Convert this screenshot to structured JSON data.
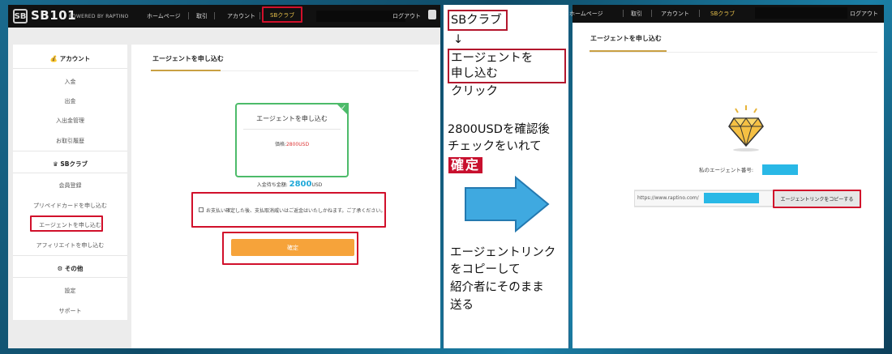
{
  "left": {
    "logo_icon": "SB",
    "logo_text": "SB101",
    "powered": "POWERED BY RAPTINO",
    "nav": [
      "ホームページ",
      "取引",
      "アカウント",
      "SBクラブ"
    ],
    "logout": "ログアウト",
    "sidebar": {
      "account_head": "アカウント",
      "account_items": [
        "入金",
        "出金",
        "入出金管理",
        "お取引履歴"
      ],
      "club_head": "SBクラブ",
      "club_items": [
        "会員登録",
        "プリペイドカードを申し込む",
        "エージェントを申し込む",
        "アフィリエイトを申し込む"
      ],
      "other_head": "その他",
      "other_items": [
        "設定",
        "サポート"
      ]
    },
    "main_title": "エージェントを申し込む",
    "card": {
      "title": "エージェントを申し込む",
      "price_label": "価格:",
      "price_value": "2800USD"
    },
    "balance": {
      "label": "入金待ち金額:",
      "amount": "2800",
      "unit": "USD"
    },
    "agree_text": "お支払い確定した後、支払取消威いはご返金はいたしかねます。ご了承ください。",
    "confirm_label": "確定"
  },
  "middle": {
    "step1": "SBクラブ",
    "arrow_down": "↓",
    "step2_line1": "エージェントを",
    "step2_line2": "申し込む",
    "click": "クリック",
    "instr_line1": "2800USDを確認後",
    "instr_line2": "チェックをいれて",
    "kakutei": "確定",
    "copy_line1": "エージェントリンク",
    "copy_line2": "をコピーして",
    "copy_line3": "紹介者にそのまま",
    "copy_line4": "送る"
  },
  "right": {
    "nav": [
      "ホームページ",
      "取引",
      "アカウント",
      "SBクラブ"
    ],
    "logout": "ログアウト",
    "title": "エージェントを申し込む",
    "agent_no_label": "私のエージェント番号:",
    "link_text": "https://www.raptino.com/",
    "copy_button": "エージェントリンクをコピーする"
  },
  "colors": {
    "highlight": "#d1102b",
    "gold": "#c9a043",
    "card_green": "#4dbb6a",
    "confirm_orange": "#f6a33a",
    "accent_cyan": "#29b8e6",
    "arrow_blue": "#3fa9e0"
  }
}
